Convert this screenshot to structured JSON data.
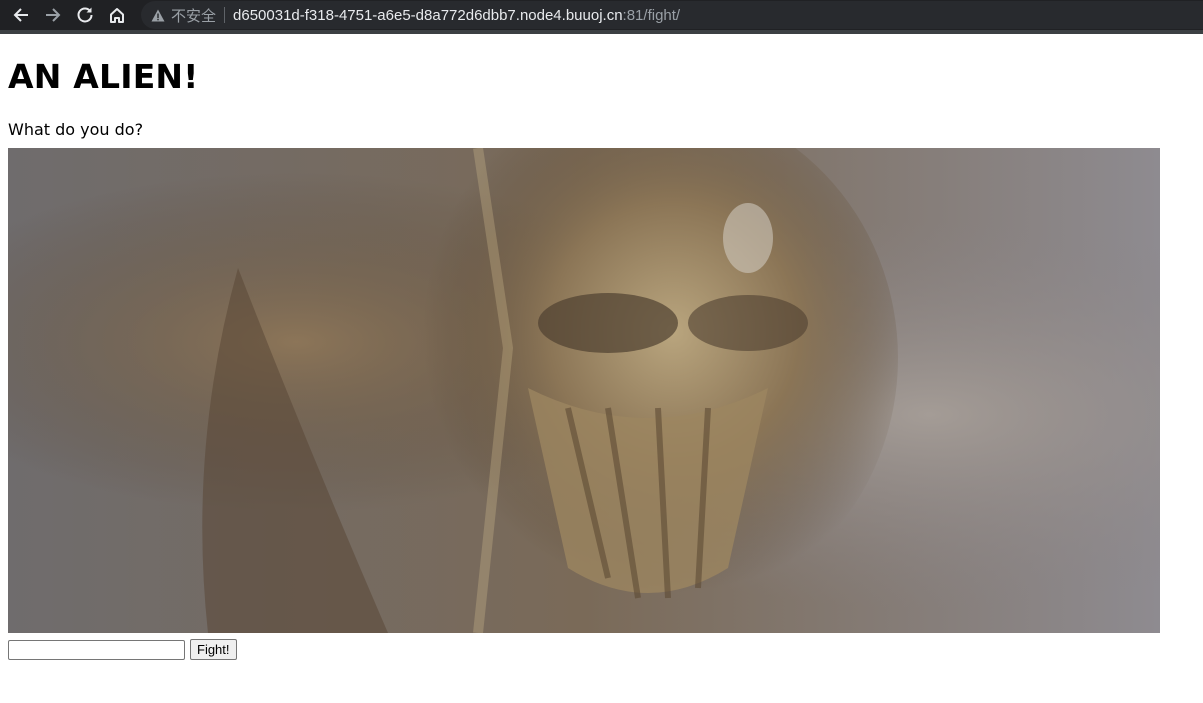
{
  "browser": {
    "security_label": "不安全",
    "url_host": "d650031d-f318-4751-a6e5-d8a772d6dbb7.node4.buuoj.cn",
    "url_rest": ":81/fight/",
    "icons": [
      "back-icon",
      "forward-icon",
      "reload-icon",
      "home-icon",
      "warning-icon"
    ]
  },
  "page": {
    "title": "AN ALIEN!",
    "question": "What do you do?",
    "image_icon": "alien-image",
    "input_value": "",
    "fight_button_label": "Fight!"
  }
}
